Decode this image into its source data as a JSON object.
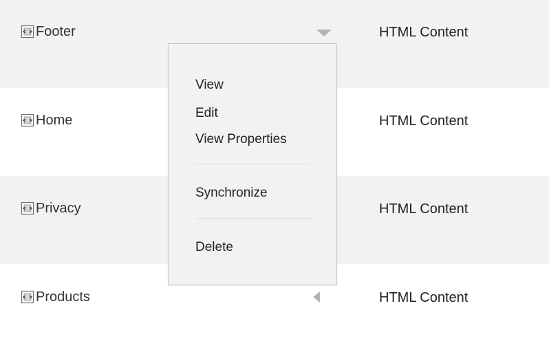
{
  "rows": [
    {
      "name": "Footer",
      "type": "HTML Content"
    },
    {
      "name": "Home",
      "type": "HTML Content"
    },
    {
      "name": "Privacy",
      "type": "HTML Content"
    },
    {
      "name": "Products",
      "type": "HTML Content"
    }
  ],
  "context_menu": {
    "items": {
      "view": "View",
      "edit": "Edit",
      "view_properties": "View Properties",
      "synchronize": "Synchronize",
      "delete": "Delete"
    }
  },
  "icons": {
    "row_icon": "html-document-icon",
    "menu_open_arrow": "triangle-down-icon",
    "menu_closed_arrow": "triangle-left-icon"
  },
  "colors": {
    "row_shaded": "#f2f2f2",
    "row_plain": "#ffffff",
    "menu_background": "#f2f2f2",
    "menu_border": "#c9c9c9"
  }
}
